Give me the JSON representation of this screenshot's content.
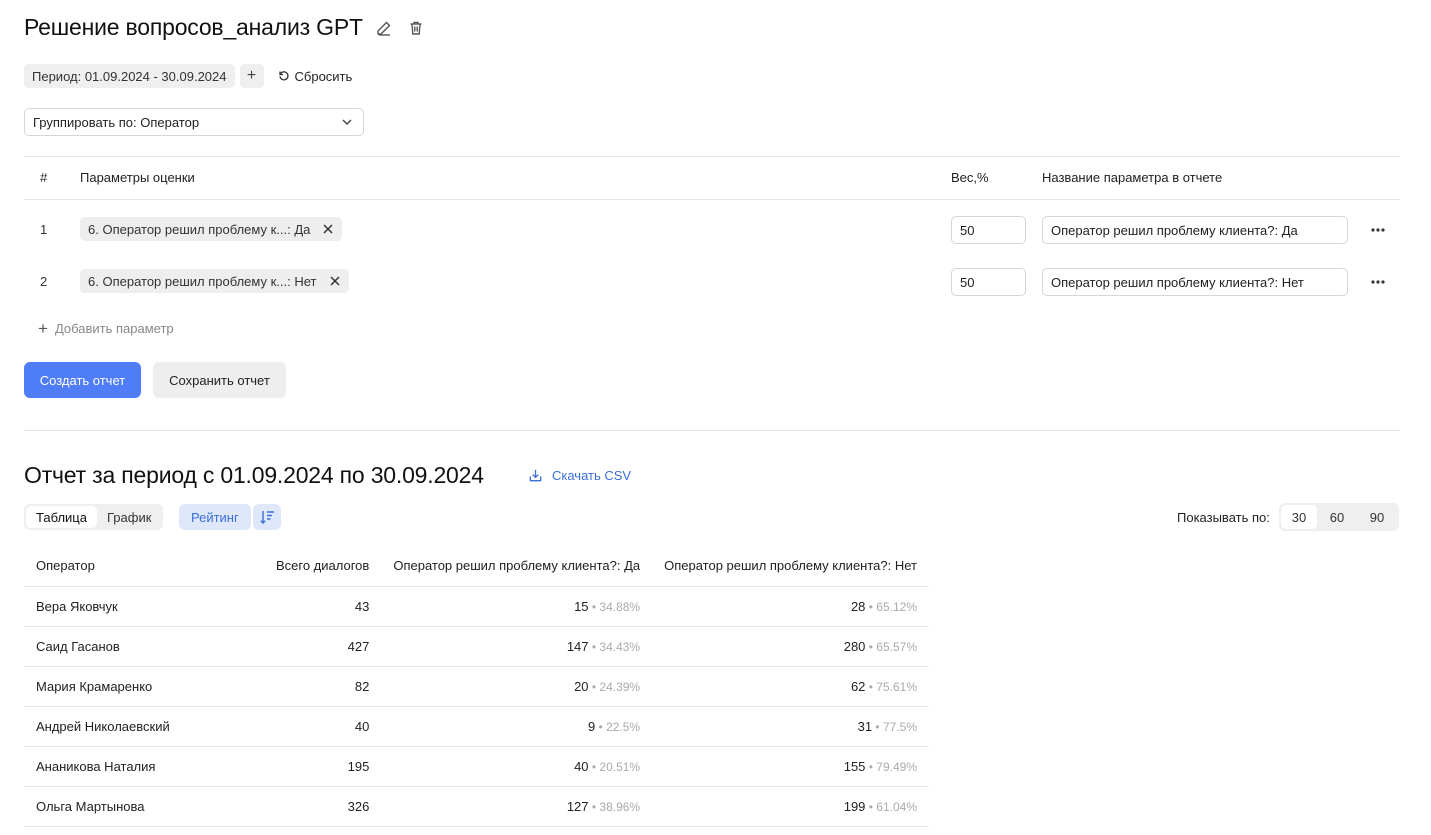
{
  "header": {
    "title": "Решение вопросов_анализ GPT",
    "edit_icon": "pencil-icon",
    "delete_icon": "trash-icon"
  },
  "filters": {
    "period_label": "Период: 01.09.2024 - 30.09.2024",
    "add_label": "+",
    "reset_label": "Сбросить"
  },
  "grouping": {
    "label": "Группировать по: Оператор"
  },
  "params_table": {
    "headers": {
      "num": "#",
      "params": "Параметры оценки",
      "weight": "Вес,%",
      "name": "Название параметра в отчете"
    },
    "rows": [
      {
        "num": "1",
        "tag": "6. Оператор решил проблему к...: Да",
        "weight": "50",
        "report_name": "Оператор решил проблему клиента?: Да"
      },
      {
        "num": "2",
        "tag": "6. Оператор решил проблему к...: Нет",
        "weight": "50",
        "report_name": "Оператор решил проблему клиента?: Нет"
      }
    ],
    "add_param_label": "Добавить параметр"
  },
  "actions": {
    "create_label": "Создать отчет",
    "save_label": "Сохранить отчет"
  },
  "report": {
    "title": "Отчет за период с 01.09.2024 по 30.09.2024",
    "csv_label": "Скачать CSV",
    "view_tabs": [
      "Таблица",
      "График"
    ],
    "active_view": "Таблица",
    "rating_label": "Рейтинг",
    "per_page_label": "Показывать по:",
    "per_page_options": [
      "30",
      "60",
      "90"
    ],
    "per_page_selected": "30",
    "columns": [
      "Оператор",
      "Всего диалогов",
      "Оператор решил проблему клиента?: Да",
      "Оператор решил проблему клиента?: Нет"
    ],
    "rows": [
      {
        "operator": "Вера Яковчук",
        "total": "43",
        "yes": "15",
        "yes_pct": "34.88%",
        "no": "28",
        "no_pct": "65.12%"
      },
      {
        "operator": "Саид Гасанов",
        "total": "427",
        "yes": "147",
        "yes_pct": "34.43%",
        "no": "280",
        "no_pct": "65.57%"
      },
      {
        "operator": "Мария Крамаренко",
        "total": "82",
        "yes": "20",
        "yes_pct": "24.39%",
        "no": "62",
        "no_pct": "75.61%"
      },
      {
        "operator": "Андрей Николаевский",
        "total": "40",
        "yes": "9",
        "yes_pct": "22.5%",
        "no": "31",
        "no_pct": "77.5%"
      },
      {
        "operator": "Ананикова Наталия",
        "total": "195",
        "yes": "40",
        "yes_pct": "20.51%",
        "no": "155",
        "no_pct": "79.49%"
      },
      {
        "operator": "Ольга Мартынова",
        "total": "326",
        "yes": "127",
        "yes_pct": "38.96%",
        "no": "199",
        "no_pct": "61.04%"
      }
    ]
  },
  "colors": {
    "primary": "#4f7cf7",
    "link": "#3b6fd9",
    "chip_bg": "#efefef",
    "accent_bg": "#dfe7fb"
  }
}
